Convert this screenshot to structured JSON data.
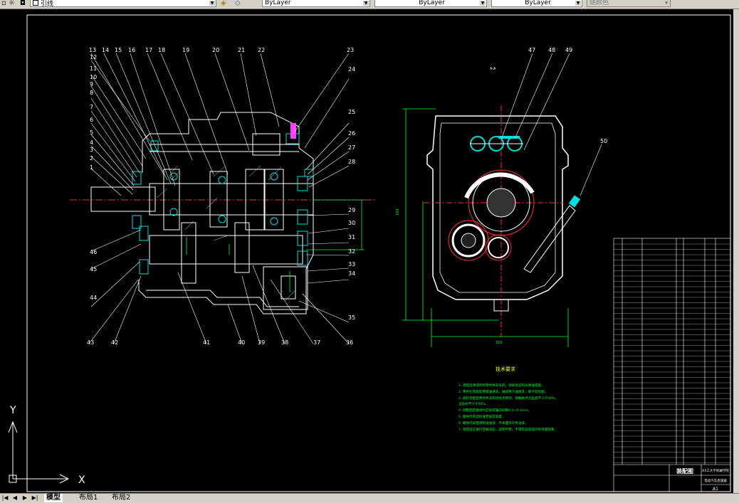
{
  "toolbar": {
    "layer_value": "引线",
    "color_value": "ByLayer",
    "linetype_value": "ByLayer",
    "lineweight_value": "ByLayer",
    "plotstyle_value": "随颜色"
  },
  "drawing": {
    "left_callouts_top": [
      "13",
      "14",
      "15",
      "16",
      "17",
      "18",
      "19",
      "20",
      "21",
      "22",
      "23"
    ],
    "left_callouts_side": [
      "12",
      "11",
      "10",
      "9",
      "8",
      "7",
      "6",
      "5",
      "4",
      "3",
      "2",
      "1"
    ],
    "right_callouts": [
      "24",
      "25",
      "26",
      "27",
      "28",
      "29",
      "30",
      "31",
      "32",
      "33",
      "34",
      "35"
    ],
    "bottom_callouts": [
      "43",
      "42",
      "41",
      "40",
      "39",
      "38",
      "37",
      "36"
    ],
    "lower_left_callouts": [
      "46",
      "45",
      "44"
    ],
    "section_label": "A-A",
    "section_callouts": [
      "47",
      "48",
      "49",
      "50"
    ],
    "dim_height": "333",
    "dim_width": "310"
  },
  "tech_requirements": {
    "title": "技术要求",
    "lines": [
      "1. 装配前清洗所有零件并去毛刺，涂抹合适的润滑油或脂。",
      "2. 零件在装配前用煤油清洗，轴承用汽油清洗，晾干后装配。",
      "3. 齿轮装配后用涂色法检验啮合情况，接触斑点沿齿高不小于40%，",
      "   沿齿长不小于50%。",
      "4. 调整固定轴承时应留有轴向间隙0.2~0.3mm。",
      "5. 箱体内装齿轮油至规定高度。",
      "6. 箱体内表面涂耐油油漆，外表面涂灰色油漆。",
      "7. 装配后应进行空载试验，运转平稳，不得有异常噪声和渗漏现象。"
    ]
  },
  "title_block": {
    "drawing_name": "装配图",
    "school": "XX工大学机械学院",
    "part_name": "电动汽车变速器",
    "sheet": "A1"
  },
  "ucs": {
    "x_label": "X",
    "y_label": "Y"
  },
  "tabs": [
    "模型",
    "布局1",
    "布局2"
  ]
}
